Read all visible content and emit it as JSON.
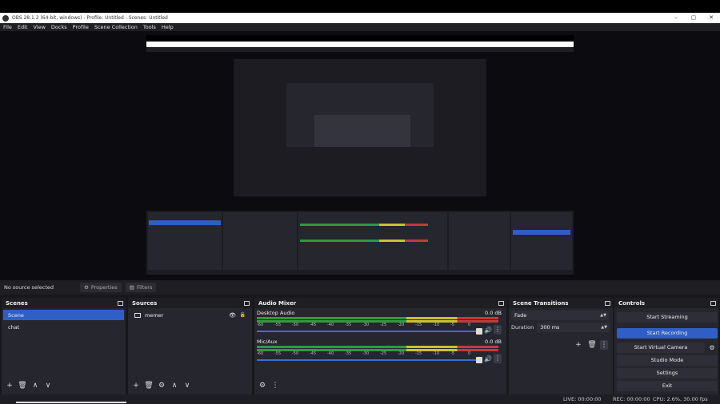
{
  "window": {
    "title": "OBS 28.1.2 (64-bit, windows) - Profile: Untitled - Scenes: Untitled",
    "controls": [
      "–",
      "▢",
      "✕"
    ]
  },
  "menu": [
    "File",
    "Edit",
    "View",
    "Docks",
    "Profile",
    "Scene Collection",
    "Tools",
    "Help"
  ],
  "source_toolbar": {
    "status": "No source selected",
    "properties": "Properties",
    "filters": "Filters"
  },
  "scenes": {
    "title": "Scenes",
    "items": [
      {
        "label": "Scene",
        "selected": true
      },
      {
        "label": "chat",
        "selected": false
      }
    ],
    "toolbar": [
      "+",
      "🗑",
      "∧",
      "∨"
    ]
  },
  "sources": {
    "title": "Sources",
    "items": [
      {
        "label": "memer"
      }
    ],
    "toolbar": [
      "+",
      "🗑",
      "⚙",
      "∧",
      "∨"
    ]
  },
  "mixer": {
    "title": "Audio Mixer",
    "channels": [
      {
        "name": "Desktop Audio",
        "db": "0.0 dB"
      },
      {
        "name": "Mic/Aux",
        "db": "0.0 dB"
      }
    ],
    "ticks": [
      "-60",
      "-55",
      "-50",
      "-45",
      "-40",
      "-35",
      "-30",
      "-25",
      "-20",
      "-15",
      "-10",
      "-5",
      "0"
    ]
  },
  "transitions": {
    "title": "Scene Transitions",
    "selected": "Fade",
    "duration_label": "Duration",
    "duration_value": "300 ms"
  },
  "controls": {
    "title": "Controls",
    "start_streaming": "Start Streaming",
    "start_recording": "Start Recording",
    "start_virtual_camera": "Start Virtual Camera",
    "studio_mode": "Studio Mode",
    "settings": "Settings",
    "exit": "Exit"
  },
  "status": {
    "live": "LIVE: 00:00:00",
    "rec": "REC: 00:00:00",
    "cpu": "CPU: 2.6%, 30.00 fps"
  },
  "colors": {
    "accent": "#2f5fc6",
    "panel": "#26262e",
    "background": "#18181c"
  }
}
